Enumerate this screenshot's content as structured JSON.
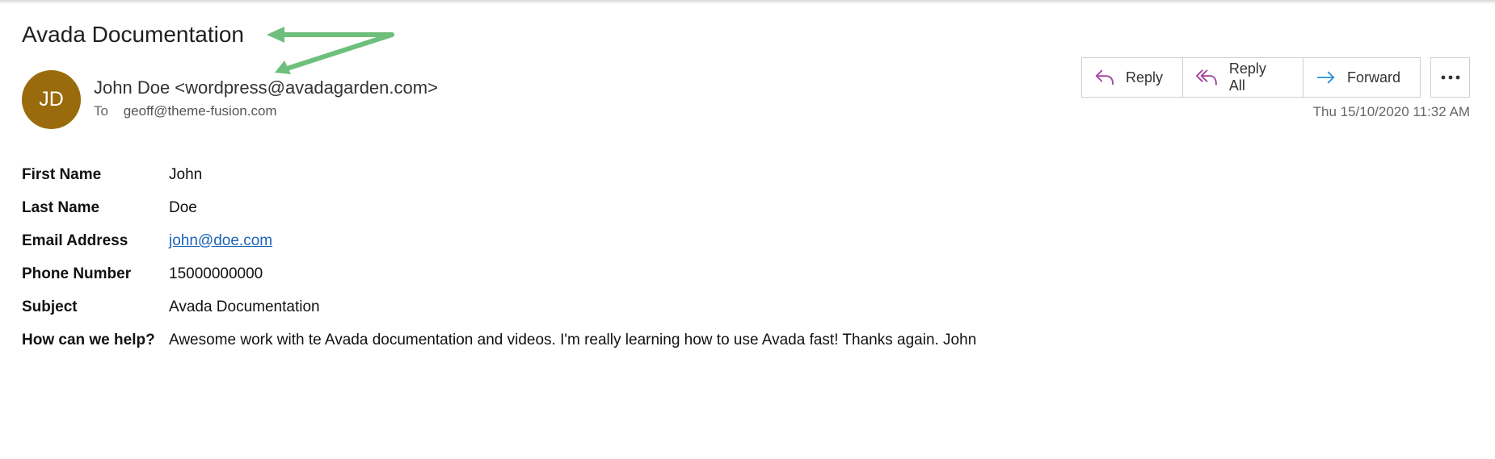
{
  "email": {
    "subject": "Avada Documentation",
    "avatar_initials": "JD",
    "avatar_color": "#9a6b0c",
    "sender": "John Doe <wordpress@avadagarden.com>",
    "to_label": "To",
    "to_address": "geoff@theme-fusion.com",
    "timestamp": "Thu 15/10/2020 11:32 AM"
  },
  "actions": {
    "reply_label": "Reply",
    "reply_all_label": "Reply All",
    "forward_label": "Forward",
    "reply_icon": "reply-icon",
    "reply_all_icon": "reply-all-icon",
    "forward_icon": "forward-icon",
    "more_icon": "more-options-icon",
    "reply_color": "#a3449b",
    "forward_color": "#2b8fd6"
  },
  "annotation": {
    "arrow_color": "#6dbf7b"
  },
  "fields": [
    {
      "label": "First Name",
      "value": "John"
    },
    {
      "label": "Last Name",
      "value": "Doe"
    },
    {
      "label": "Email Address",
      "value": "john@doe.com"
    },
    {
      "label": "Phone Number",
      "value": "15000000000"
    },
    {
      "label": "Subject",
      "value": "Avada Documentation"
    },
    {
      "label": "How can we help?",
      "value": "Awesome work with te Avada documentation and videos. I'm really learning how to use Avada fast! Thanks again. John"
    }
  ]
}
